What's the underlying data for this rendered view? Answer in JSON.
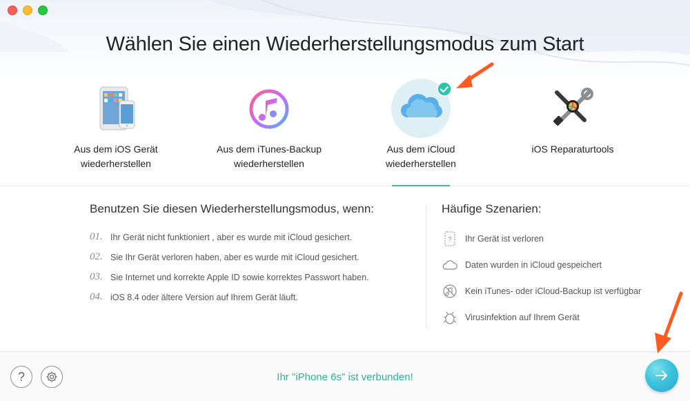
{
  "window": {
    "title": ""
  },
  "header": {
    "title": "Wählen Sie einen Wiederherstellungsmodus zum Start"
  },
  "modes": [
    {
      "id": "ios-device",
      "label_line1": "Aus dem iOS Gerät",
      "label_line2": "wiederherstellen",
      "icon": "ios-devices-icon",
      "selected": false
    },
    {
      "id": "itunes-backup",
      "label_line1": "Aus dem iTunes-Backup",
      "label_line2": "wiederherstellen",
      "icon": "itunes-icon",
      "selected": false
    },
    {
      "id": "icloud",
      "label_line1": "Aus dem iCloud",
      "label_line2": "wiederherstellen",
      "icon": "icloud-icon",
      "selected": true
    },
    {
      "id": "repair-tools",
      "label_line1": "iOS Reparaturtools",
      "label_line2": "",
      "icon": "repair-tools-icon",
      "selected": false
    }
  ],
  "usage": {
    "heading": "Benutzen Sie diesen Wiederherstellungsmodus, wenn:",
    "items": [
      {
        "num": "01.",
        "text": "Ihr Gerät nicht funktioniert , aber es wurde mit iCloud gesichert."
      },
      {
        "num": "02.",
        "text": "Sie Ihr Gerät verloren haben, aber es wurde mit iCloud gesichert."
      },
      {
        "num": "03.",
        "text": "Sie Internet und korrekte Apple ID sowie korrektes Passwort haben."
      },
      {
        "num": "04.",
        "text": "iOS 8.4 oder ältere Version auf Ihrem Gerät läuft."
      }
    ]
  },
  "scenarios": {
    "heading": "Häufige Szenarien:",
    "items": [
      {
        "icon": "lost-phone-icon",
        "text": "Ihr Gerät ist verloren"
      },
      {
        "icon": "cloud-icon",
        "text": "Daten wurden in iCloud gespeichert"
      },
      {
        "icon": "no-backup-icon",
        "text": "Kein iTunes- oder iCloud-Backup ist verfügbar"
      },
      {
        "icon": "bug-icon",
        "text": "Virusinfektion auf Ihrem Gerät"
      }
    ]
  },
  "footer": {
    "help_label": "?",
    "status": "Ihr \"iPhone 6s\" ist verbunden!"
  },
  "colors": {
    "accent": "#2ec4a9",
    "status_text": "#2bb49a",
    "annotation_arrow": "#ff5a1f",
    "next_button": "#3cc3dc"
  }
}
